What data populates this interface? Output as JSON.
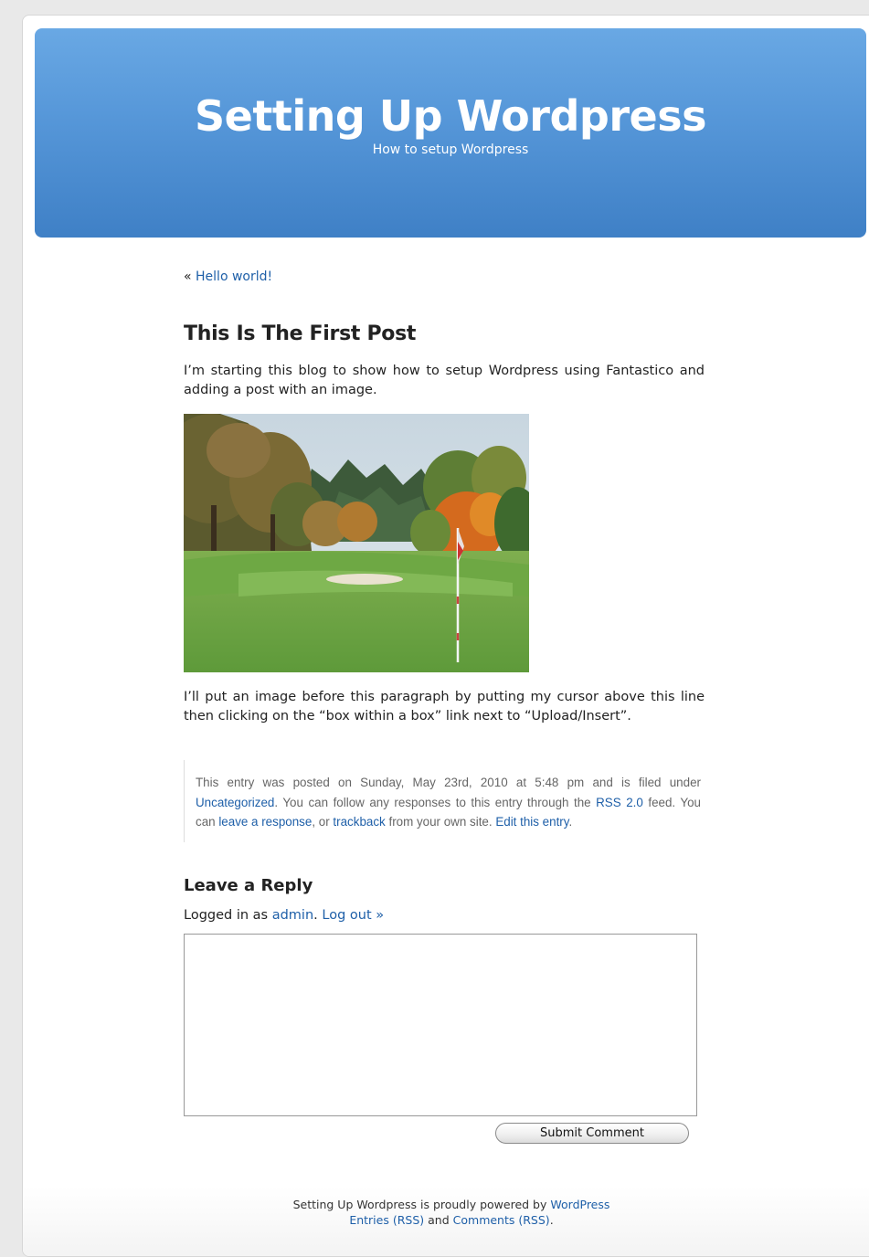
{
  "header": {
    "title": "Setting Up Wordpress",
    "description": "How to setup Wordpress"
  },
  "navigation": {
    "prev_arrow": "«",
    "prev_link": "Hello world!"
  },
  "post": {
    "title": "This Is The First Post",
    "paragraph1": "I’m starting this blog to show how to setup Wordpress using Fantastico and adding a post with an image.",
    "image_description": "golf course fairway with flag and autumn trees",
    "paragraph2": "I’ll put an image before this paragraph by putting my cursor above this line then clicking on the “box within a box” link next to “Upload/Insert”."
  },
  "postmetadata": {
    "text1": "This entry was posted on Sunday, May 23rd, 2010 at 5:48 pm and is filed under",
    "category_link": "Uncategorized",
    "text2": ". You can follow any responses to this entry through the",
    "rss_link": "RSS 2.0",
    "text3": "feed. You can",
    "response_link": "leave a response",
    "text4": ", or",
    "trackback_link": "trackback",
    "text5": "from your own site.",
    "edit_link": "Edit this entry",
    "text6": "."
  },
  "reply": {
    "title": "Leave a Reply",
    "logged_in_prefix": "Logged in as",
    "user_link": "admin",
    "separator": ".",
    "logout_link": "Log out »",
    "comment_value": "",
    "submit_label": "Submit Comment"
  },
  "footer": {
    "powered_prefix": "Setting Up Wordpress is proudly powered by",
    "wordpress_link": "WordPress",
    "entries_rss_link": "Entries (RSS)",
    "and_text": "and",
    "comments_rss_link": "Comments (RSS)",
    "end_punct": "."
  },
  "colors": {
    "header_gradient_top": "#69a8e4",
    "header_gradient_bottom": "#3f80c6",
    "link": "#1e5fa8"
  }
}
